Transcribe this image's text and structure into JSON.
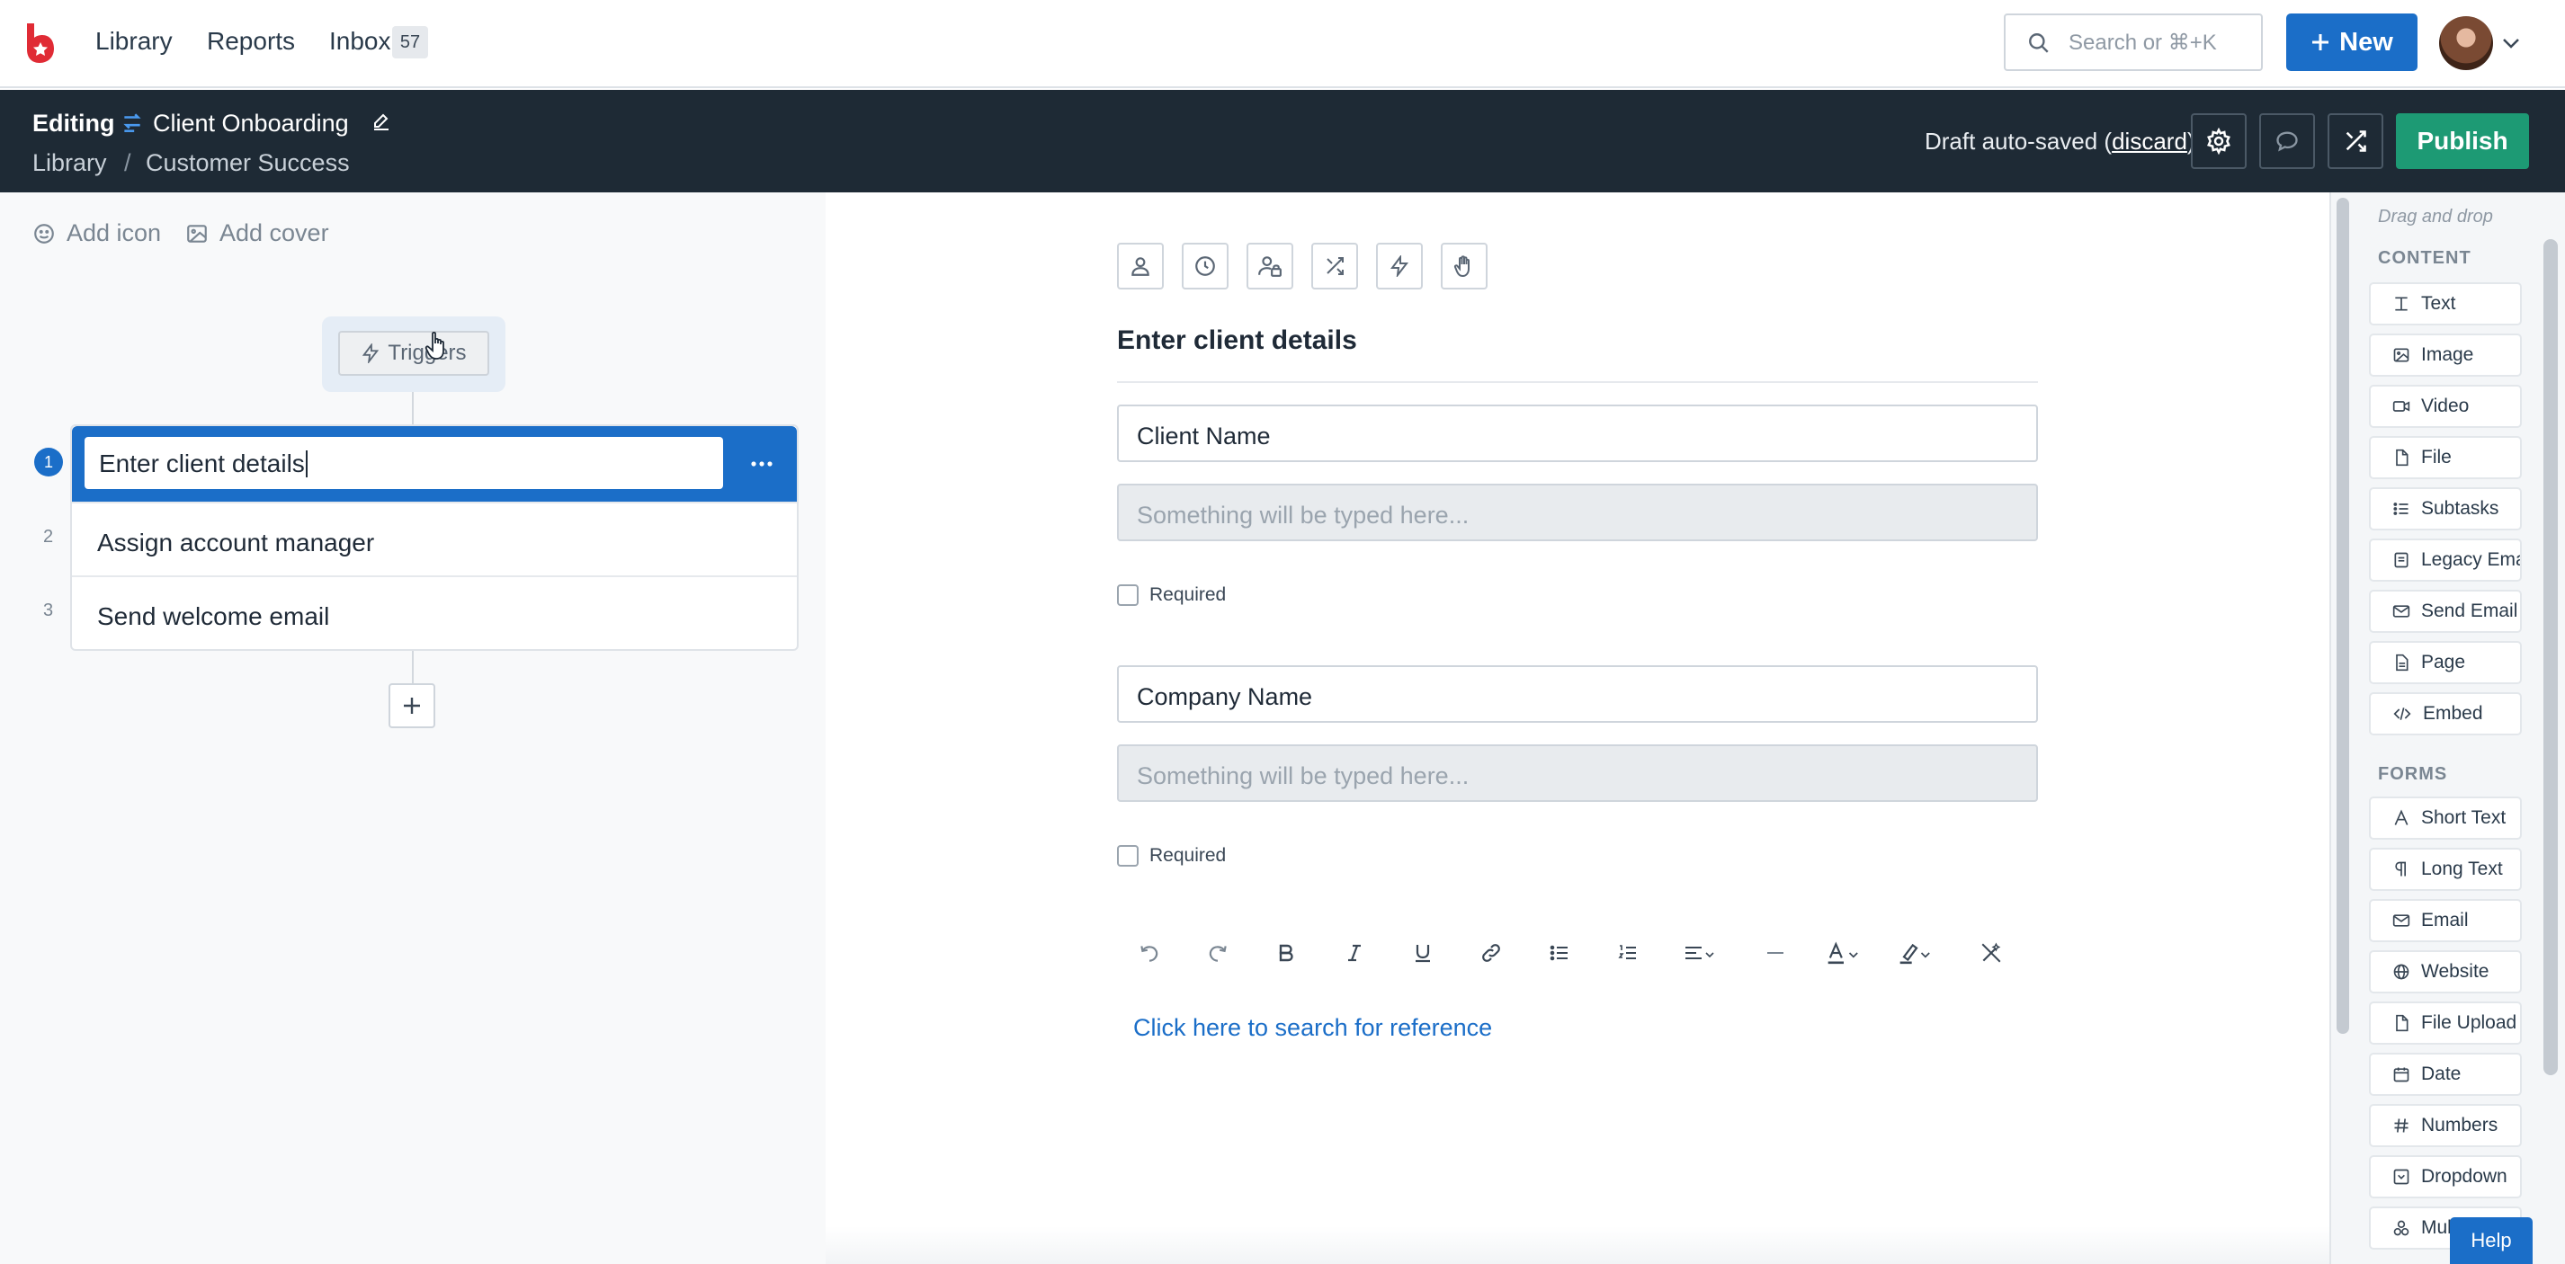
{
  "nav": {
    "library": "Library",
    "reports": "Reports",
    "inbox": "Inbox",
    "inbox_count": "57",
    "search_placeholder": "Search or ⌘+K",
    "new_label": "New"
  },
  "editor": {
    "mode": "Editing",
    "title": "Client Onboarding",
    "breadcrumb": [
      "Library",
      "Customer Success"
    ],
    "draft_prefix": "Draft auto-saved (",
    "discard": "discard",
    "draft_suffix": ")",
    "publish": "Publish"
  },
  "left": {
    "add_icon": "Add icon",
    "add_cover": "Add cover",
    "triggers": "Triggers",
    "tasks": [
      {
        "num": "1",
        "title": "Enter client details"
      },
      {
        "num": "2",
        "title": "Assign account manager"
      },
      {
        "num": "3",
        "title": "Send welcome email"
      }
    ]
  },
  "canvas": {
    "task_title": "Enter client details",
    "fields": [
      {
        "label": "Client Name",
        "placeholder": "Something will be typed here...",
        "required_label": "Required"
      },
      {
        "label": "Company Name",
        "placeholder": "Something will be typed here...",
        "required_label": "Required"
      }
    ],
    "reference_link": "Click here to search for reference"
  },
  "sidebar": {
    "hint": "Drag and drop",
    "content_title": "CONTENT",
    "content_items": [
      "Text",
      "Image",
      "Video",
      "File",
      "Subtasks",
      "Legacy Email",
      "Send Email",
      "Page",
      "Embed"
    ],
    "forms_title": "FORMS",
    "form_items": [
      "Short Text",
      "Long Text",
      "Email",
      "Website",
      "File Upload",
      "Date",
      "Numbers",
      "Dropdown",
      "Multi"
    ]
  },
  "help": "Help",
  "colors": {
    "brand_red": "#e02b35",
    "primary_blue": "#1b6ec8",
    "publish_green": "#1d9a74",
    "header_dark": "#1e2a35"
  }
}
